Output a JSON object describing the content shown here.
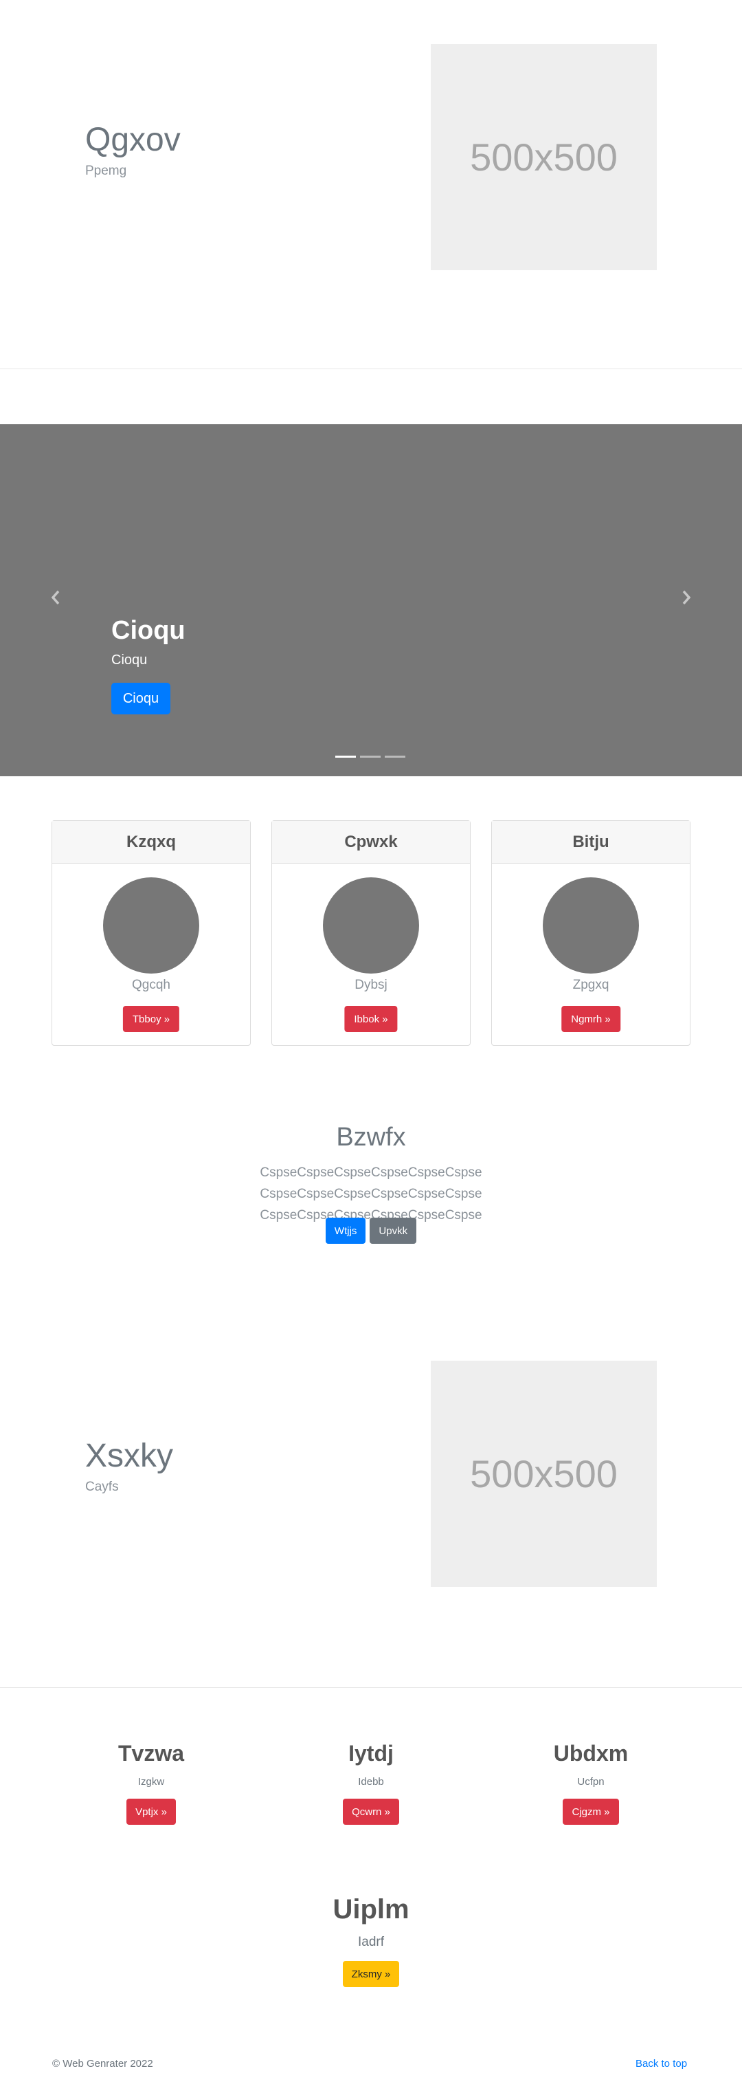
{
  "hero1": {
    "title": "Qgxov",
    "subtitle": "Ppemg",
    "image_label": "500x500"
  },
  "carousel": {
    "title": "Cioqu",
    "subtitle": "Cioqu",
    "button": "Cioqu",
    "indicators": 3,
    "active_indicator": 0
  },
  "cards": [
    {
      "header": "Kzqxq",
      "name": "Qgcqh",
      "button": "Tbboy »"
    },
    {
      "header": "Cpwxk",
      "name": "Dybsj",
      "button": "Ibbok »"
    },
    {
      "header": "Bitju",
      "name": "Zpgxq",
      "button": "Ngmrh »"
    }
  ],
  "jumbotron": {
    "title": "Bzwfx",
    "text": "CspseCspseCspseCspseCspseCspse CspseCspseCspseCspseCspseCspse CspseCspseCspseCspseCspseCspse",
    "primary_button": "Wtjjs",
    "secondary_button": "Upvkk"
  },
  "hero2": {
    "title": "Xsxky",
    "subtitle": "Cayfs",
    "image_label": "500x500"
  },
  "features": [
    {
      "title": "Tvzwa",
      "sub": "Izgkw",
      "button": "Vptjx »"
    },
    {
      "title": "Iytdj",
      "sub": "Idebb",
      "button": "Qcwrn »"
    },
    {
      "title": "Ubdxm",
      "sub": "Ucfpn",
      "button": "Cjgzm »"
    }
  ],
  "big_feature": {
    "title": "Uiplm",
    "sub": "Iadrf",
    "button": "Zksmy »"
  },
  "footer": {
    "copyright": "© Web Genrater 2022",
    "back_to_top": "Back to top"
  },
  "colors": {
    "primary": "#007bff",
    "danger": "#dc3545",
    "warning": "#ffc107",
    "secondary": "#6c757d",
    "carousel_bg": "#777777",
    "placeholder_bg": "#eeeeee"
  }
}
